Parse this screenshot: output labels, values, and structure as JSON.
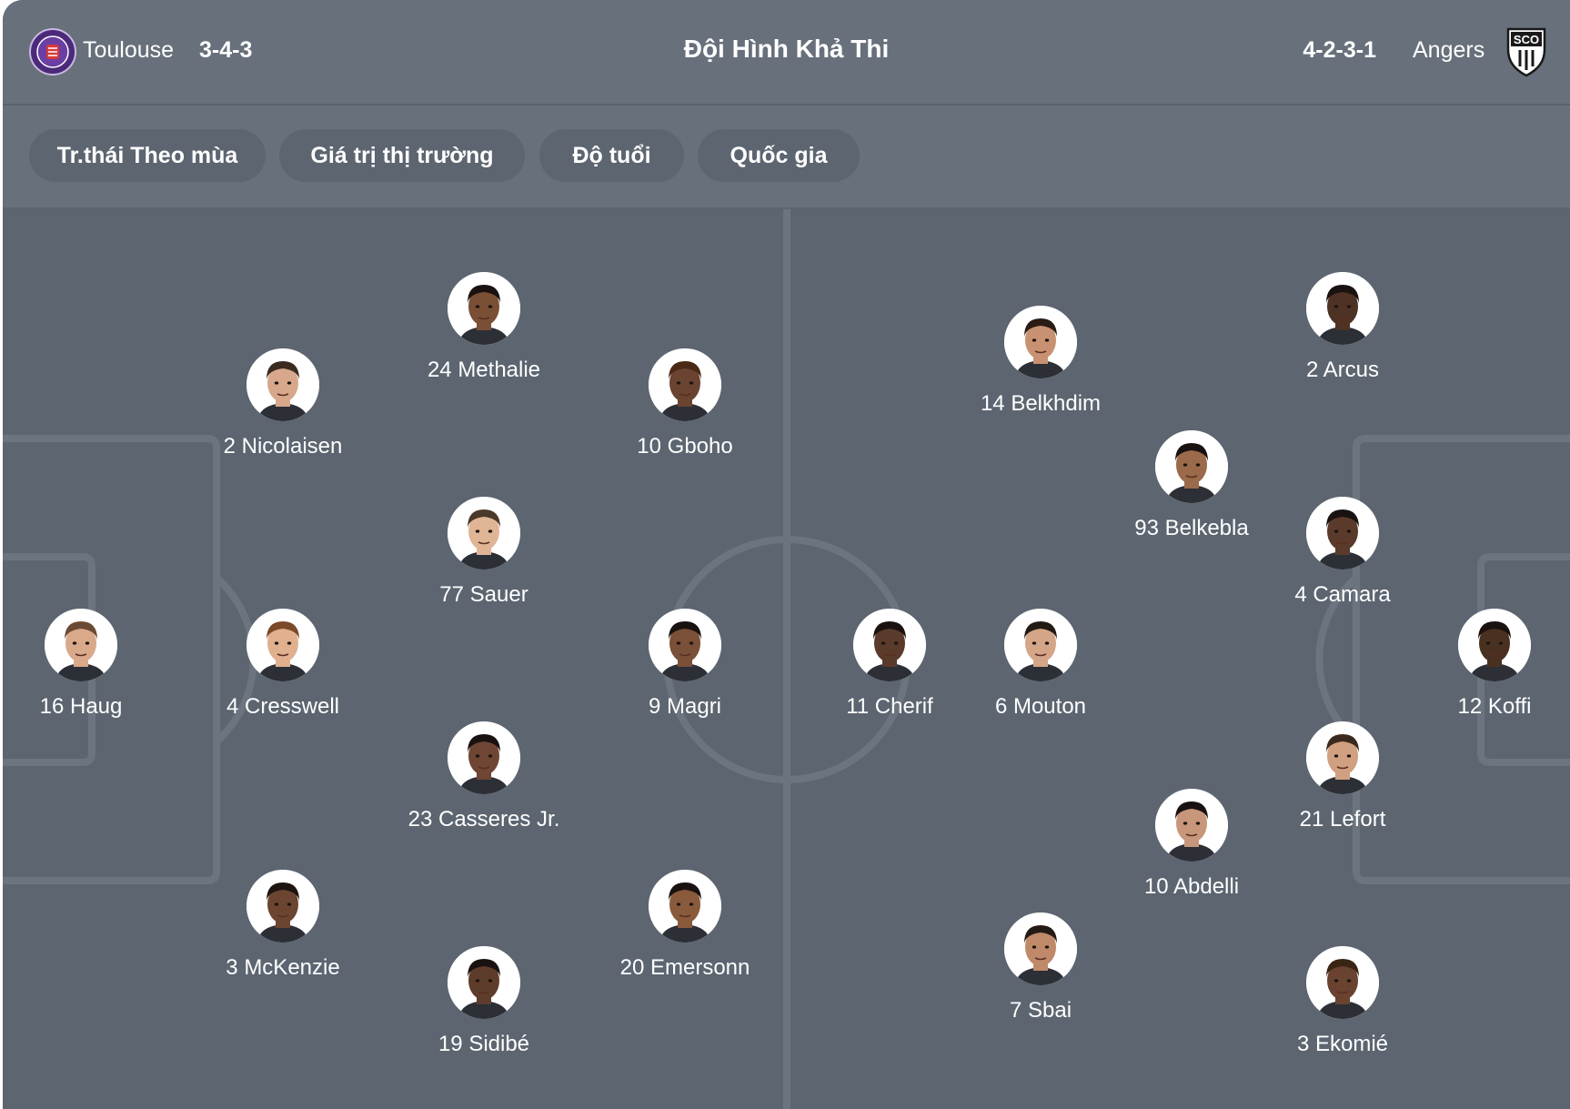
{
  "header": {
    "home_team": "Toulouse",
    "home_formation": "3-4-3",
    "title": "Đội Hình Khả Thi",
    "away_formation": "4-2-3-1",
    "away_team": "Angers",
    "away_logo_text": "SCO"
  },
  "filters": [
    {
      "label": "Tr.thái Theo mùa"
    },
    {
      "label": "Giá trị thị trường"
    },
    {
      "label": "Độ tuổi"
    },
    {
      "label": "Quốc gia"
    }
  ],
  "colors": {
    "background": "#5c6570",
    "header": "#67707b",
    "pitch_lines": "#6c757f",
    "text": "#ffffff"
  },
  "home_players": [
    {
      "label": "16 Haug",
      "skin": "#d9a98a",
      "hair": "#6b4a33"
    },
    {
      "label": "2 Nicolaisen",
      "skin": "#d7a88b",
      "hair": "#3b2a20"
    },
    {
      "label": "4 Cresswell",
      "skin": "#e0b08f",
      "hair": "#7a4a2a"
    },
    {
      "label": "3 McKenzie",
      "skin": "#6b4530",
      "hair": "#1d1410"
    },
    {
      "label": "24 Methalie",
      "skin": "#7a4f36",
      "hair": "#1a1210"
    },
    {
      "label": "77 Sauer",
      "skin": "#e0b596",
      "hair": "#4a3a2c"
    },
    {
      "label": "23 Casseres Jr.",
      "skin": "#6e4633",
      "hair": "#1a1210"
    },
    {
      "label": "19 Sidibé",
      "skin": "#5e3c2b",
      "hair": "#1a1210"
    },
    {
      "label": "10 Gboho",
      "skin": "#6a4431",
      "hair": "#4a2a16"
    },
    {
      "label": "9 Magri",
      "skin": "#7a5038",
      "hair": "#1a1210"
    },
    {
      "label": "20 Emersonn",
      "skin": "#8a5a3c",
      "hair": "#1a1210"
    }
  ],
  "away_players": [
    {
      "label": "11 Cherif",
      "skin": "#5a3a2a",
      "hair": "#1a1210"
    },
    {
      "label": "14 Belkhdim",
      "skin": "#c89272",
      "hair": "#2a1c14"
    },
    {
      "label": "6 Mouton",
      "skin": "#d4a587",
      "hair": "#241a14"
    },
    {
      "label": "7 Sbai",
      "skin": "#c08a6a",
      "hair": "#241a14"
    },
    {
      "label": "93 Belkebla",
      "skin": "#9a6a4a",
      "hair": "#1a1210"
    },
    {
      "label": "10 Abdelli",
      "skin": "#c8967a",
      "hair": "#1a1210"
    },
    {
      "label": "2 Arcus",
      "skin": "#4e3224",
      "hair": "#1a1210"
    },
    {
      "label": "4 Camara",
      "skin": "#5a3a2a",
      "hair": "#1a1210"
    },
    {
      "label": "21 Lefort",
      "skin": "#d0a080",
      "hair": "#3a2a1e"
    },
    {
      "label": "3 Ekomié",
      "skin": "#6a4230",
      "hair": "#3a2414"
    },
    {
      "label": "12 Koffi",
      "skin": "#4a3020",
      "hair": "#1a1210"
    }
  ]
}
